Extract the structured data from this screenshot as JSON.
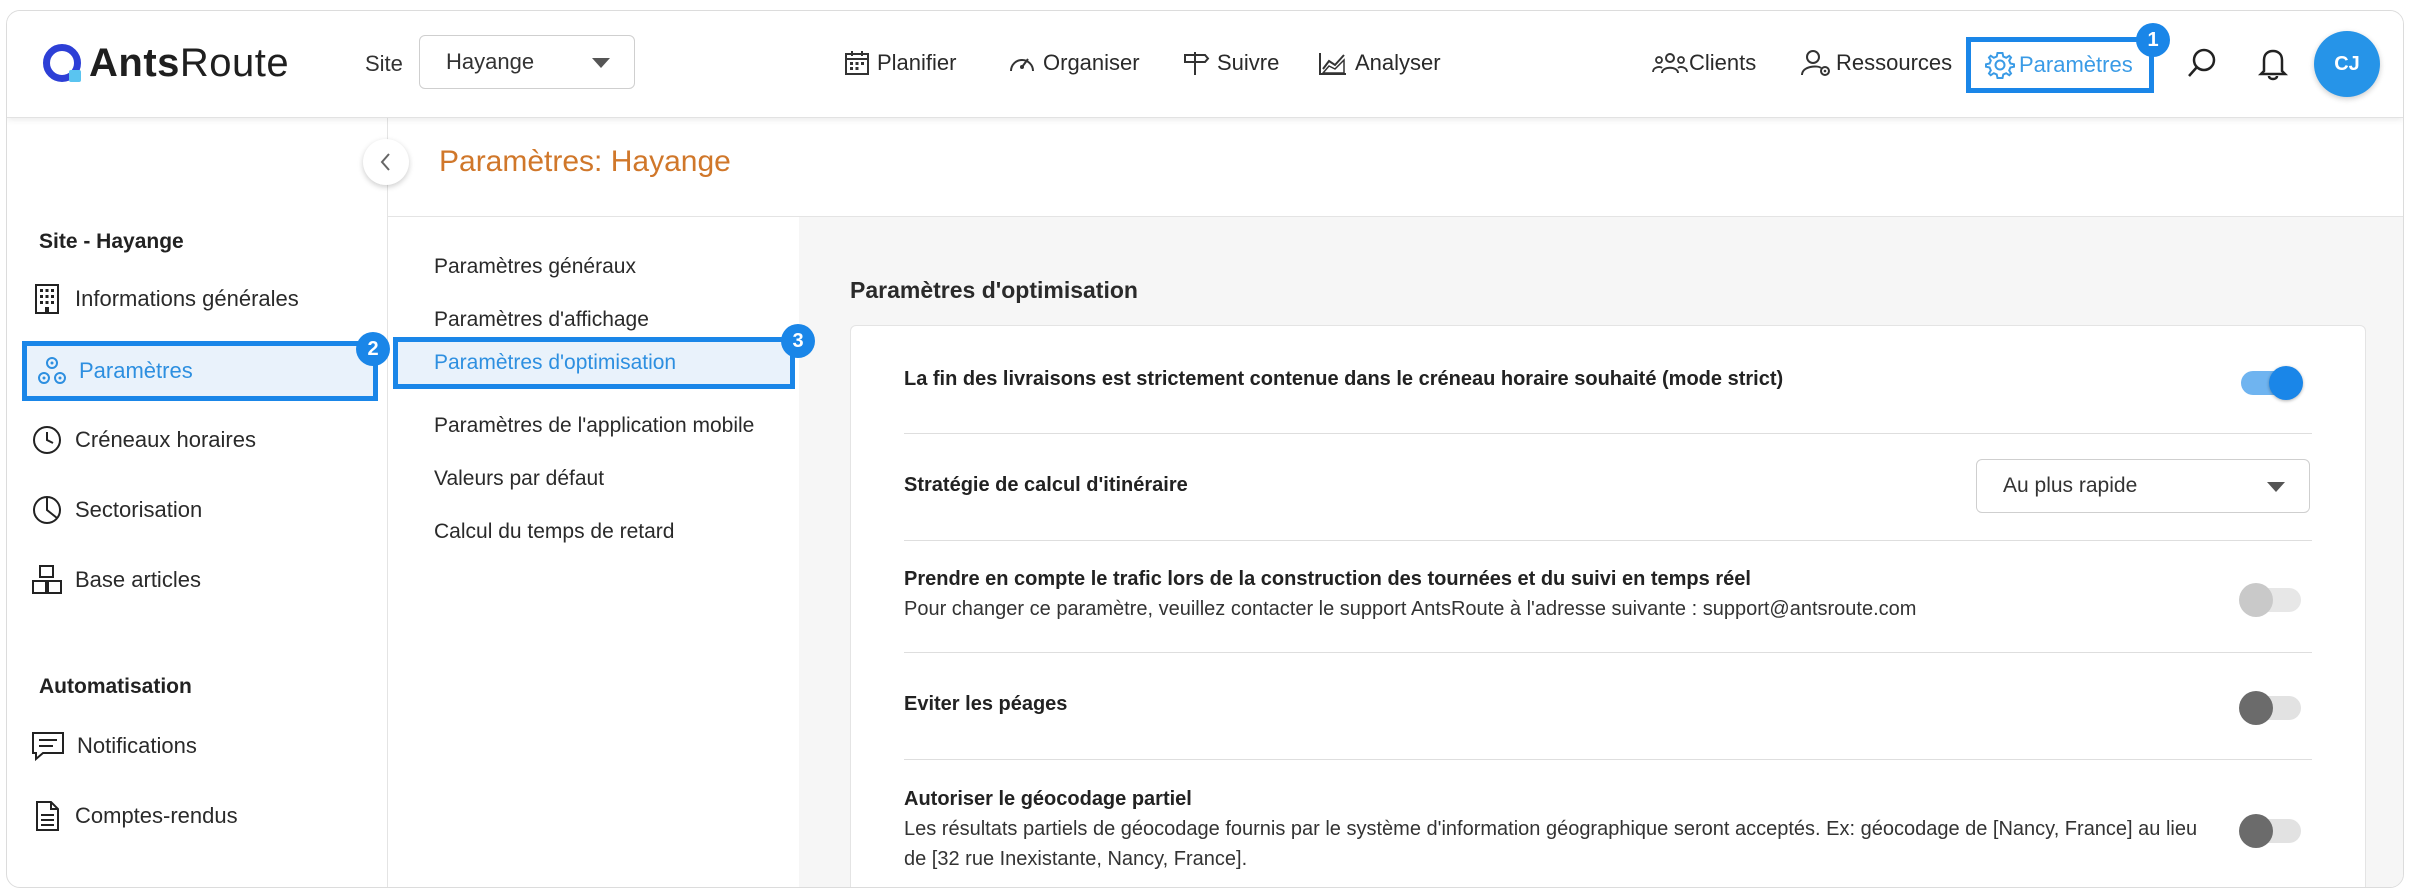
{
  "app": {
    "logo_bold": "Ants",
    "logo_light": "Route"
  },
  "header": {
    "site_label": "Site",
    "site_value": "Hayange",
    "nav": [
      {
        "label": "Planifier",
        "icon": "calendar-icon"
      },
      {
        "label": "Organiser",
        "icon": "speedometer-icon"
      },
      {
        "label": "Suivre",
        "icon": "signpost-icon"
      },
      {
        "label": "Analyser",
        "icon": "chart-icon"
      }
    ],
    "clients_label": "Clients",
    "resources_label": "Ressources",
    "params_label": "Paramètres",
    "avatar_initials": "CJ"
  },
  "badges": {
    "b1": "1",
    "b2": "2",
    "b3": "3"
  },
  "sidebar": {
    "section1": "Site - Hayange",
    "items1": [
      {
        "label": "Informations générales",
        "icon": "building-icon"
      },
      {
        "label": "Paramètres",
        "icon": "gears-icon"
      },
      {
        "label": "Créneaux horaires",
        "icon": "clock-icon"
      },
      {
        "label": "Sectorisation",
        "icon": "pie-icon"
      },
      {
        "label": "Base articles",
        "icon": "boxes-icon"
      }
    ],
    "section2": "Automatisation",
    "items2": [
      {
        "label": "Notifications",
        "icon": "message-icon"
      },
      {
        "label": "Comptes-rendus",
        "icon": "document-icon"
      }
    ]
  },
  "page": {
    "title": "Paramètres: Hayange"
  },
  "submenu": [
    "Paramètres généraux",
    "Paramètres d'affichage",
    "Paramètres d'optimisation",
    "Paramètres de l'application mobile",
    "Valeurs par défaut",
    "Calcul du temps de retard"
  ],
  "optimisation": {
    "title": "Paramètres d'optimisation",
    "rows": [
      {
        "label": "La fin des livraisons est strictement contenue dans le créneau horaire souhaité (mode strict)",
        "toggle": "on"
      },
      {
        "label": "Stratégie de calcul d'itinéraire",
        "select_value": "Au plus rapide"
      },
      {
        "label": "Prendre en compte le trafic lors de la construction des tournées et du suivi en temps réel",
        "desc": "Pour changer ce paramètre, veuillez contacter le support AntsRoute à l'adresse suivante : support@antsroute.com",
        "toggle": "disabled"
      },
      {
        "label": "Eviter les péages",
        "toggle": "off"
      },
      {
        "label": "Autoriser le géocodage partiel",
        "desc": "Les résultats partiels de géocodage fournis par le système d'information géographique seront acceptés. Ex: géocodage de [Nancy, France] au lieu de [32 rue Inexistante, Nancy, France].",
        "toggle": "off"
      }
    ]
  },
  "colors": {
    "accent": "#1a86e8",
    "title_orange": "#d0772a"
  }
}
